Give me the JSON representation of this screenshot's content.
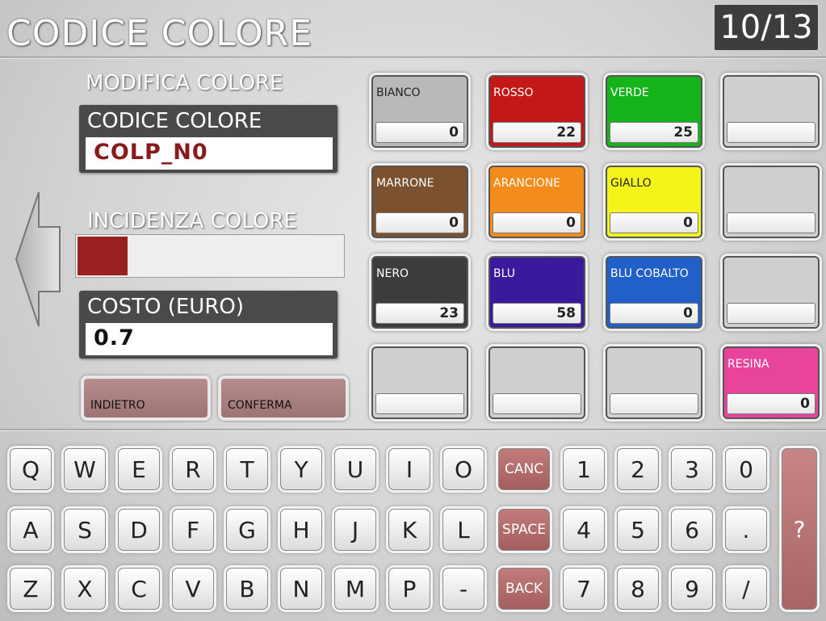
{
  "header": {
    "title": "CODICE COLORE",
    "counter": "10/13"
  },
  "left": {
    "modifica_label": "MODIFICA COLORE",
    "codice_label": "CODICE COLORE",
    "codice_value": "COLP_N0",
    "incidenza_label": "INCIDENZA COLORE",
    "incidenza_level_percent": 20,
    "costo_label": "COSTO (EURO)",
    "costo_value": "0.7",
    "btn_indietro": "INDIETRO",
    "btn_conferma": "CONFERMA"
  },
  "colors": [
    {
      "name": "BIANCO",
      "value": "0",
      "color": "#b9b9b9"
    },
    {
      "name": "ROSSO",
      "value": "22",
      "color": "#c41818"
    },
    {
      "name": "VERDE",
      "value": "25",
      "color": "#15b41a"
    },
    {
      "name": "",
      "value": "",
      "color": "#cfcfcf"
    },
    {
      "name": "MARRONE",
      "value": "0",
      "color": "#7b5130"
    },
    {
      "name": "ARANCIONE",
      "value": "0",
      "color": "#f28c1c"
    },
    {
      "name": "GIALLO",
      "value": "0",
      "color": "#f4f41a"
    },
    {
      "name": "",
      "value": "",
      "color": "#cfcfcf"
    },
    {
      "name": "NERO",
      "value": "23",
      "color": "#3c3c3c"
    },
    {
      "name": "BLU",
      "value": "58",
      "color": "#3a1a9c"
    },
    {
      "name": "BLU COBALTO",
      "value": "0",
      "color": "#2060c8"
    },
    {
      "name": "",
      "value": "",
      "color": "#cfcfcf"
    },
    {
      "name": "",
      "value": "",
      "color": "#cfcfcf"
    },
    {
      "name": "",
      "value": "",
      "color": "#cfcfcf"
    },
    {
      "name": "",
      "value": "",
      "color": "#cfcfcf"
    },
    {
      "name": "RESINA",
      "value": "0",
      "color": "#e8449c"
    }
  ],
  "keyboard": {
    "rows": [
      [
        "Q",
        "W",
        "E",
        "R",
        "T",
        "Y",
        "U",
        "I",
        "O"
      ],
      [
        "A",
        "S",
        "D",
        "F",
        "G",
        "H",
        "J",
        "K",
        "L"
      ],
      [
        "Z",
        "X",
        "C",
        "V",
        "B",
        "N",
        "M",
        "P",
        "-"
      ]
    ],
    "special": [
      "CANC",
      "SPACE",
      "BACK"
    ],
    "numpad": [
      [
        "1",
        "2",
        "3",
        "0"
      ],
      [
        "4",
        "5",
        "6",
        "."
      ],
      [
        "7",
        "8",
        "9",
        "/"
      ]
    ],
    "help": "?"
  }
}
